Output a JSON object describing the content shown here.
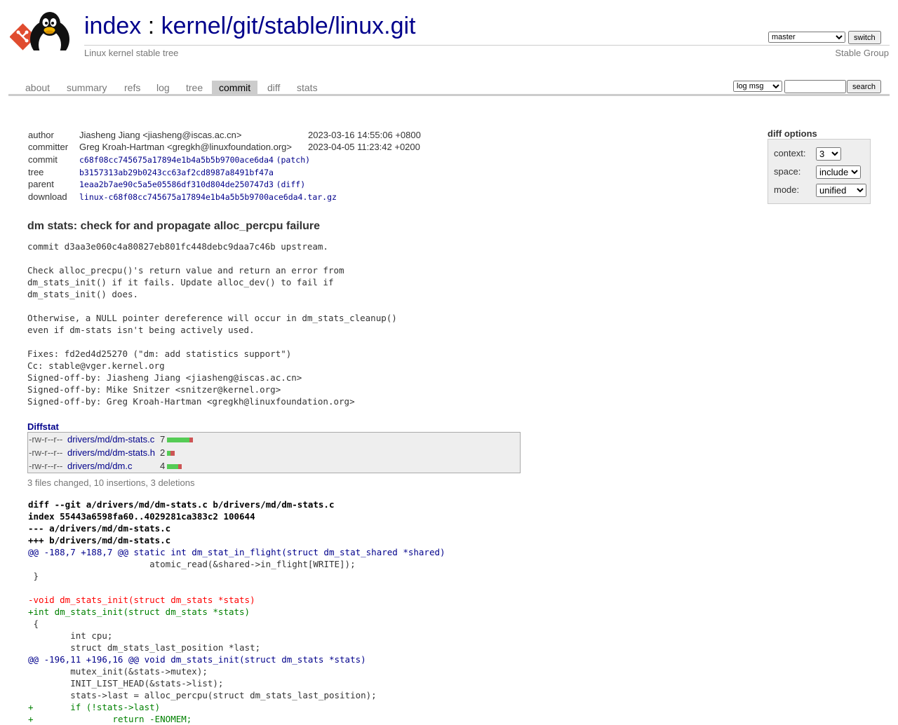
{
  "header": {
    "title_index": "index",
    "title_sep": " : ",
    "title_repo": "kernel/git/stable/linux.git",
    "subtitle": "Linux kernel stable tree",
    "branch_selected": "master",
    "switch_label": "switch",
    "group": "Stable Group"
  },
  "tabs": [
    {
      "label": "about"
    },
    {
      "label": "summary"
    },
    {
      "label": "refs"
    },
    {
      "label": "log"
    },
    {
      "label": "tree"
    },
    {
      "label": "commit",
      "active": true
    },
    {
      "label": "diff"
    },
    {
      "label": "stats"
    }
  ],
  "search": {
    "type_selected": "log msg",
    "query": "",
    "button": "search"
  },
  "commit_info": {
    "author_label": "author",
    "author": "Jiasheng Jiang <jiasheng@iscas.ac.cn>",
    "author_date": "2023-03-16 14:55:06 +0800",
    "committer_label": "committer",
    "committer": "Greg Kroah-Hartman <gregkh@linuxfoundation.org>",
    "committer_date": "2023-04-05 11:23:42 +0200",
    "commit_label": "commit",
    "commit_hash": "c68f08cc745675a17894e1b4a5b5b9700ace6da4",
    "commit_link": "(patch)",
    "tree_label": "tree",
    "tree_hash": "b3157313ab29b0243cc63af2cd8987a8491bf47a",
    "parent_label": "parent",
    "parent_hash": "1eaa2b7ae90c5a5e05586df310d804de250747d3",
    "parent_link": "(diff)",
    "download_label": "download",
    "download_file": "linux-c68f08cc745675a17894e1b4a5b5b9700ace6da4.tar.gz"
  },
  "diff_options": {
    "title": "diff options",
    "context_label": "context:",
    "context_value": "3",
    "space_label": "space:",
    "space_value": "include",
    "mode_label": "mode:",
    "mode_value": "unified"
  },
  "message": {
    "subject": "dm stats: check for and propagate alloc_percpu failure",
    "body": "commit d3aa3e060c4a80827eb801fc448debc9daa7c46b upstream.\n\nCheck alloc_precpu()'s return value and return an error from\ndm_stats_init() if it fails. Update alloc_dev() to fail if\ndm_stats_init() does.\n\nOtherwise, a NULL pointer dereference will occur in dm_stats_cleanup()\neven if dm-stats isn't being actively used.\n\nFixes: fd2ed4d25270 (\"dm: add statistics support\")\nCc: stable@vger.kernel.org\nSigned-off-by: Jiasheng Jiang <jiasheng@iscas.ac.cn>\nSigned-off-by: Mike Snitzer <snitzer@kernel.org>\nSigned-off-by: Greg Kroah-Hartman <gregkh@linuxfoundation.org>"
  },
  "diffstat": {
    "title": "Diffstat",
    "files": [
      {
        "mode": "-rw-r--r--",
        "name": "drivers/md/dm-stats.c",
        "count": "7",
        "add": 6,
        "del": 1
      },
      {
        "mode": "-rw-r--r--",
        "name": "drivers/md/dm-stats.h",
        "count": "2",
        "add": 1,
        "del": 1
      },
      {
        "mode": "-rw-r--r--",
        "name": "drivers/md/dm.c",
        "count": "4",
        "add": 3,
        "del": 1
      }
    ],
    "summary": "3 files changed, 10 insertions, 3 deletions"
  },
  "diff_lines": [
    {
      "type": "head",
      "text": "diff --git a/drivers/md/dm-stats.c b/drivers/md/dm-stats.c"
    },
    {
      "type": "head",
      "text": "index 55443a6598fa60..4029281ca383c2 100644"
    },
    {
      "type": "head",
      "text": "--- a/drivers/md/dm-stats.c"
    },
    {
      "type": "head",
      "text": "+++ b/drivers/md/dm-stats.c"
    },
    {
      "type": "hunk",
      "text": "@@ -188,7 +188,7 @@ static int dm_stat_in_flight(struct dm_stat_shared *shared)"
    },
    {
      "type": "ctx",
      "text": " \t\t       atomic_read(&shared->in_flight[WRITE]);"
    },
    {
      "type": "ctx",
      "text": " }"
    },
    {
      "type": "ctx",
      "text": " "
    },
    {
      "type": "del",
      "text": "-void dm_stats_init(struct dm_stats *stats)"
    },
    {
      "type": "add",
      "text": "+int dm_stats_init(struct dm_stats *stats)"
    },
    {
      "type": "ctx",
      "text": " {"
    },
    {
      "type": "ctx",
      "text": " \tint cpu;"
    },
    {
      "type": "ctx",
      "text": " \tstruct dm_stats_last_position *last;"
    },
    {
      "type": "hunk",
      "text": "@@ -196,11 +196,16 @@ void dm_stats_init(struct dm_stats *stats)"
    },
    {
      "type": "ctx",
      "text": " \tmutex_init(&stats->mutex);"
    },
    {
      "type": "ctx",
      "text": " \tINIT_LIST_HEAD(&stats->list);"
    },
    {
      "type": "ctx",
      "text": " \tstats->last = alloc_percpu(struct dm_stats_last_position);"
    },
    {
      "type": "add",
      "text": "+\tif (!stats->last)"
    },
    {
      "type": "add",
      "text": "+\t\treturn -ENOMEM;"
    }
  ]
}
